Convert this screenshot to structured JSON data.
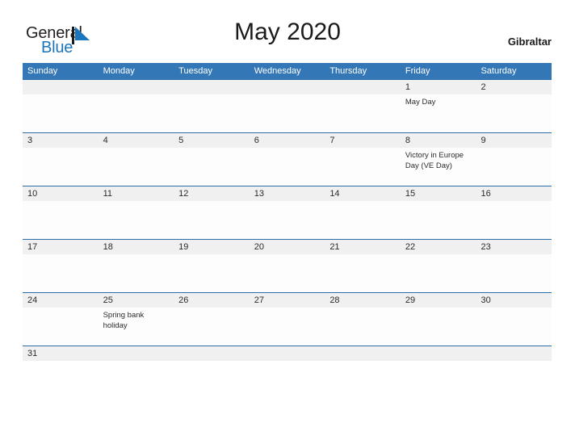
{
  "brand": {
    "name_part1": "General",
    "name_part2": "Blue",
    "flag_icon": "flag-triangle-icon"
  },
  "header": {
    "title": "May 2020",
    "region": "Gibraltar"
  },
  "calendar": {
    "weekdays": [
      "Sunday",
      "Monday",
      "Tuesday",
      "Wednesday",
      "Thursday",
      "Friday",
      "Saturday"
    ],
    "colors": {
      "header_blue": "#3477b6",
      "row_border_blue": "#2b6da8",
      "date_band_gray": "#f0f0f0",
      "brand_blue": "#1b75bb",
      "text_dark": "#2b2b2b"
    },
    "weeks": [
      {
        "days": [
          {
            "date": "",
            "event": ""
          },
          {
            "date": "",
            "event": ""
          },
          {
            "date": "",
            "event": ""
          },
          {
            "date": "",
            "event": ""
          },
          {
            "date": "",
            "event": ""
          },
          {
            "date": "1",
            "event": "May Day"
          },
          {
            "date": "2",
            "event": ""
          }
        ]
      },
      {
        "days": [
          {
            "date": "3",
            "event": ""
          },
          {
            "date": "4",
            "event": ""
          },
          {
            "date": "5",
            "event": ""
          },
          {
            "date": "6",
            "event": ""
          },
          {
            "date": "7",
            "event": ""
          },
          {
            "date": "8",
            "event": "Victory in Europe Day (VE Day)"
          },
          {
            "date": "9",
            "event": ""
          }
        ]
      },
      {
        "days": [
          {
            "date": "10",
            "event": ""
          },
          {
            "date": "11",
            "event": ""
          },
          {
            "date": "12",
            "event": ""
          },
          {
            "date": "13",
            "event": ""
          },
          {
            "date": "14",
            "event": ""
          },
          {
            "date": "15",
            "event": ""
          },
          {
            "date": "16",
            "event": ""
          }
        ]
      },
      {
        "days": [
          {
            "date": "17",
            "event": ""
          },
          {
            "date": "18",
            "event": ""
          },
          {
            "date": "19",
            "event": ""
          },
          {
            "date": "20",
            "event": ""
          },
          {
            "date": "21",
            "event": ""
          },
          {
            "date": "22",
            "event": ""
          },
          {
            "date": "23",
            "event": ""
          }
        ]
      },
      {
        "days": [
          {
            "date": "24",
            "event": ""
          },
          {
            "date": "25",
            "event": "Spring bank holiday"
          },
          {
            "date": "26",
            "event": ""
          },
          {
            "date": "27",
            "event": ""
          },
          {
            "date": "28",
            "event": ""
          },
          {
            "date": "29",
            "event": ""
          },
          {
            "date": "30",
            "event": ""
          }
        ]
      },
      {
        "last": true,
        "days": [
          {
            "date": "31",
            "event": ""
          },
          {
            "date": "",
            "event": ""
          },
          {
            "date": "",
            "event": ""
          },
          {
            "date": "",
            "event": ""
          },
          {
            "date": "",
            "event": ""
          },
          {
            "date": "",
            "event": ""
          },
          {
            "date": "",
            "event": ""
          }
        ]
      }
    ]
  }
}
